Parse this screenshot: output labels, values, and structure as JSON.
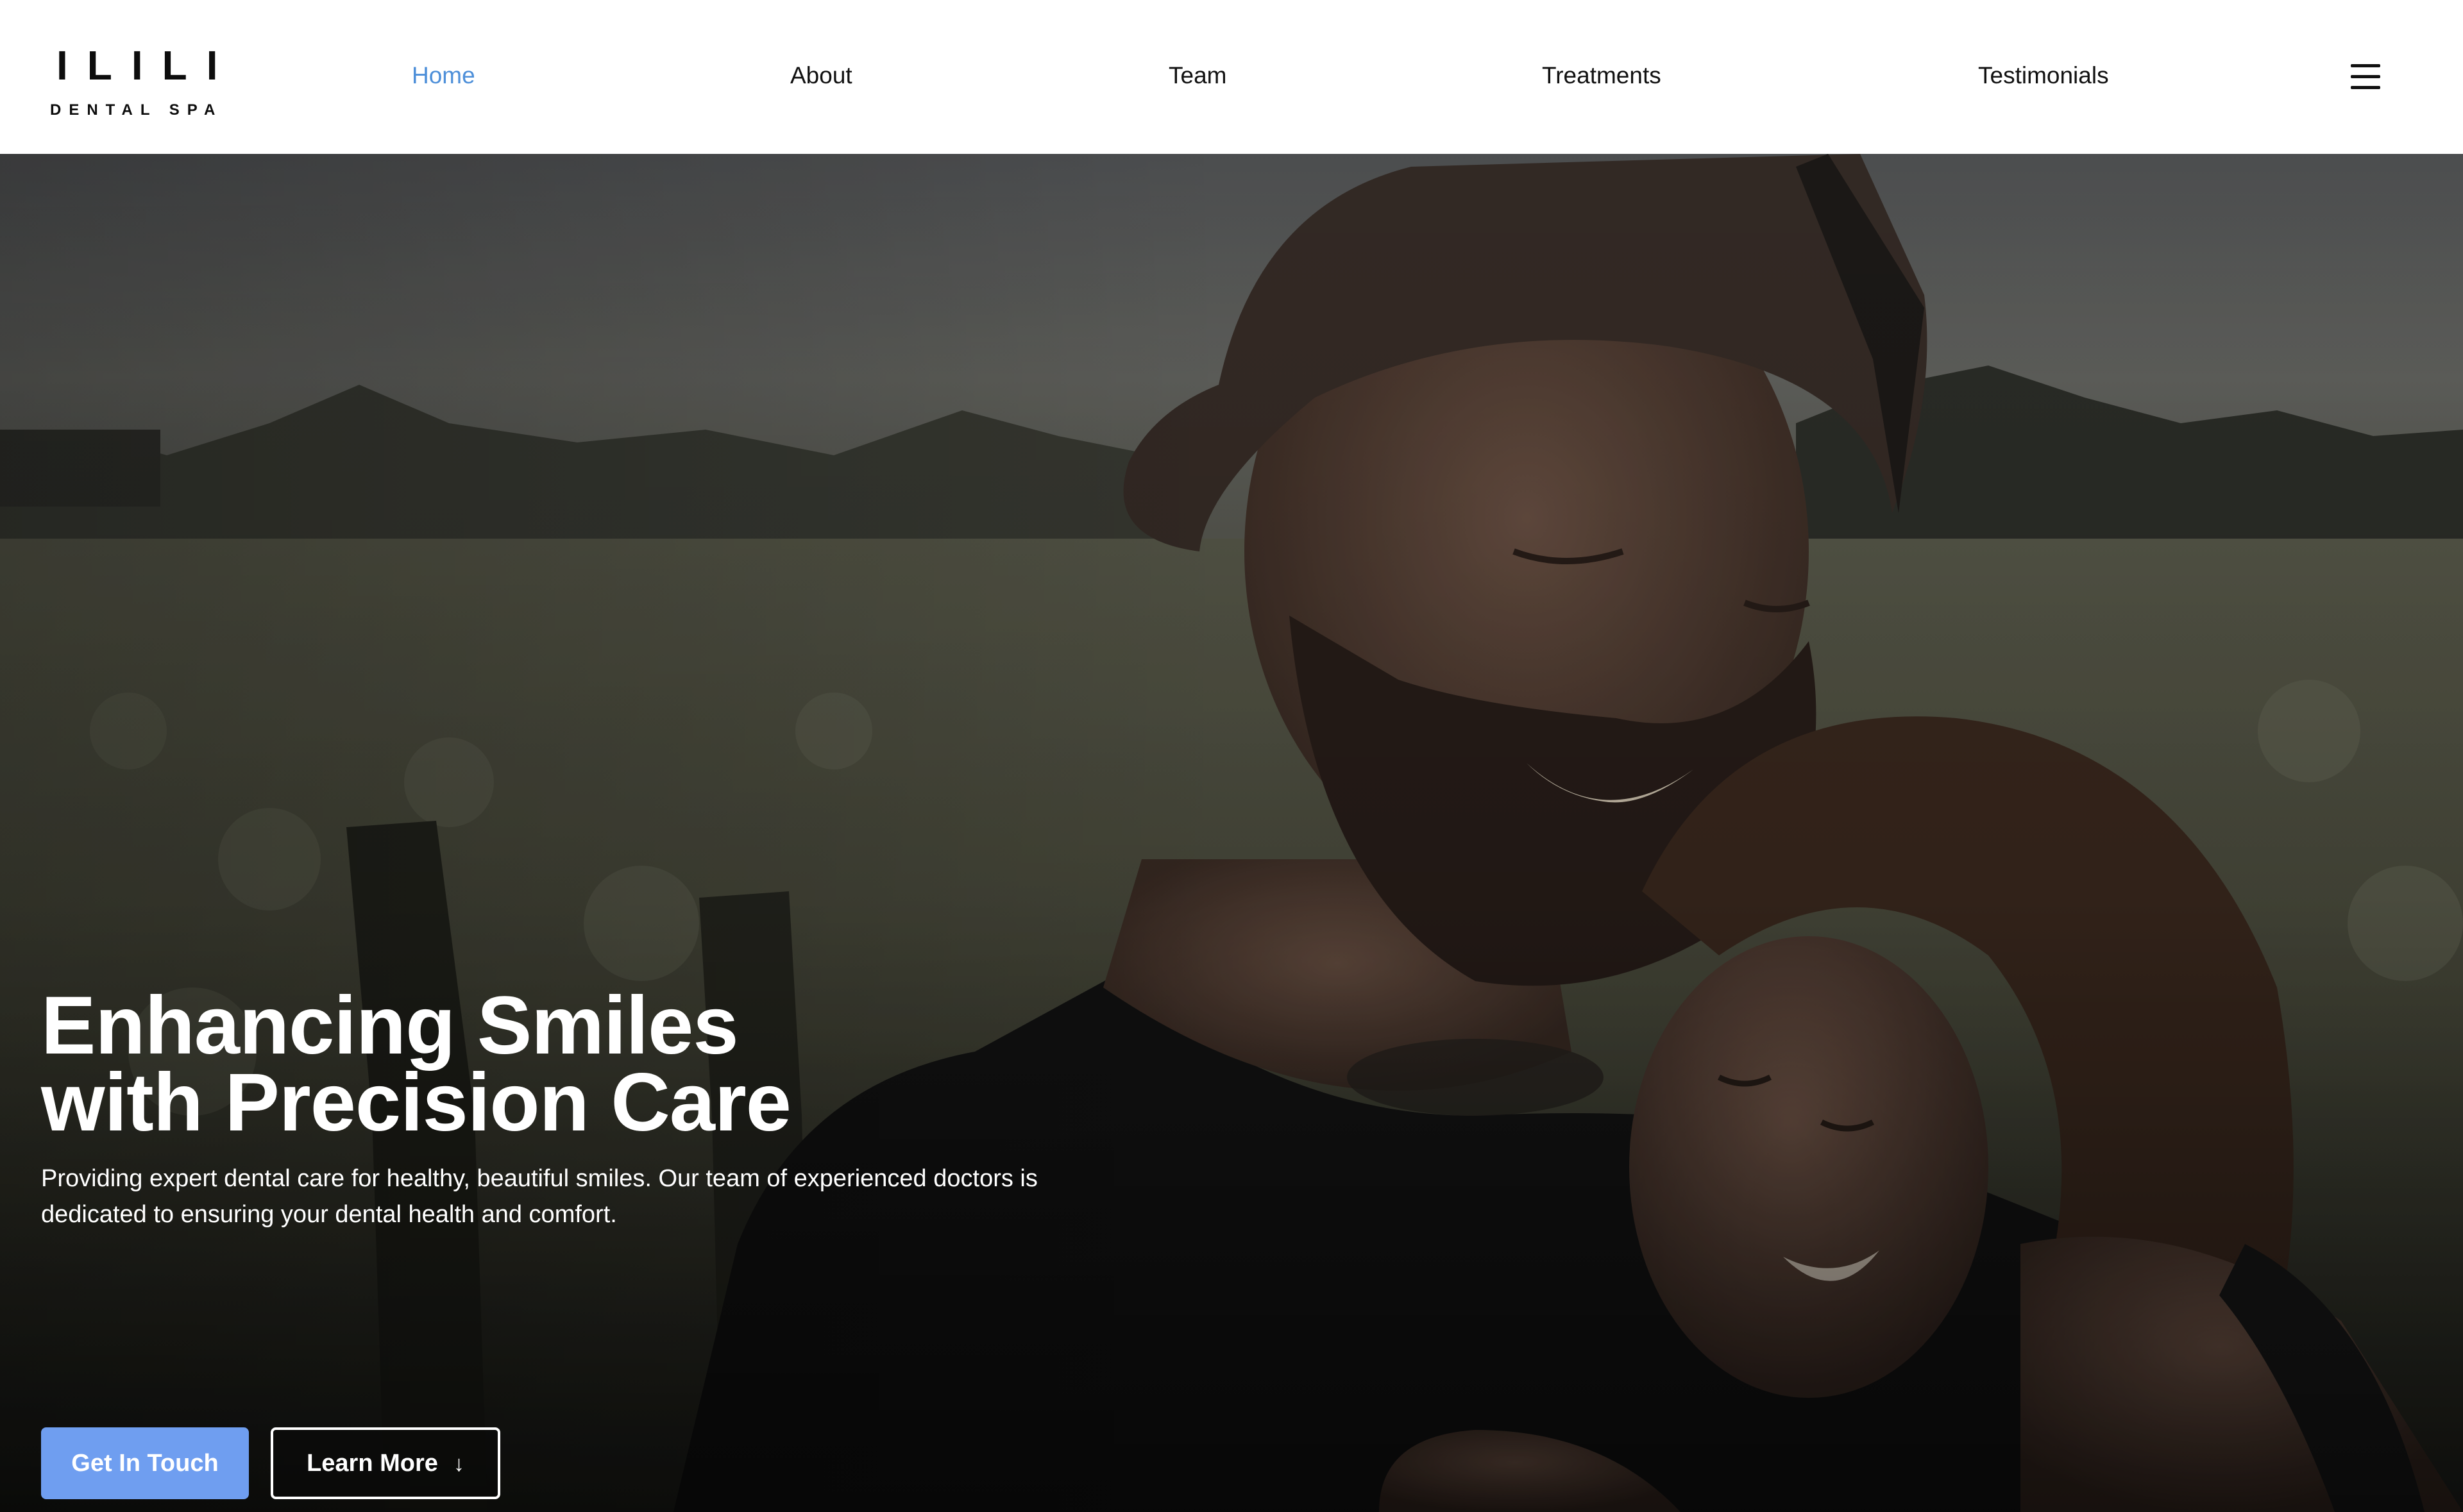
{
  "brand": {
    "name": "ILILI",
    "tagline": "DENTAL SPA"
  },
  "nav": {
    "items": [
      {
        "label": "Home",
        "active": true
      },
      {
        "label": "About",
        "active": false
      },
      {
        "label": "Team",
        "active": false
      },
      {
        "label": "Treatments",
        "active": false
      },
      {
        "label": "Testimonials",
        "active": false
      }
    ],
    "menu_icon": "hamburger-menu-icon"
  },
  "hero": {
    "title_line1": "Enhancing Smiles",
    "title_line2": "with Precision Care",
    "description": "Providing expert dental care for healthy, beautiful smiles. Our team of experienced doctors is dedicated to ensuring your dental health and comfort.",
    "primary_button": "Get In Touch",
    "secondary_button": "Learn More",
    "secondary_button_icon": "arrow-down-icon"
  },
  "colors": {
    "accent": "#4d8fd9",
    "primary_button": "#6f9ef0",
    "text_dark": "#111111",
    "hero_text": "#ffffff"
  }
}
